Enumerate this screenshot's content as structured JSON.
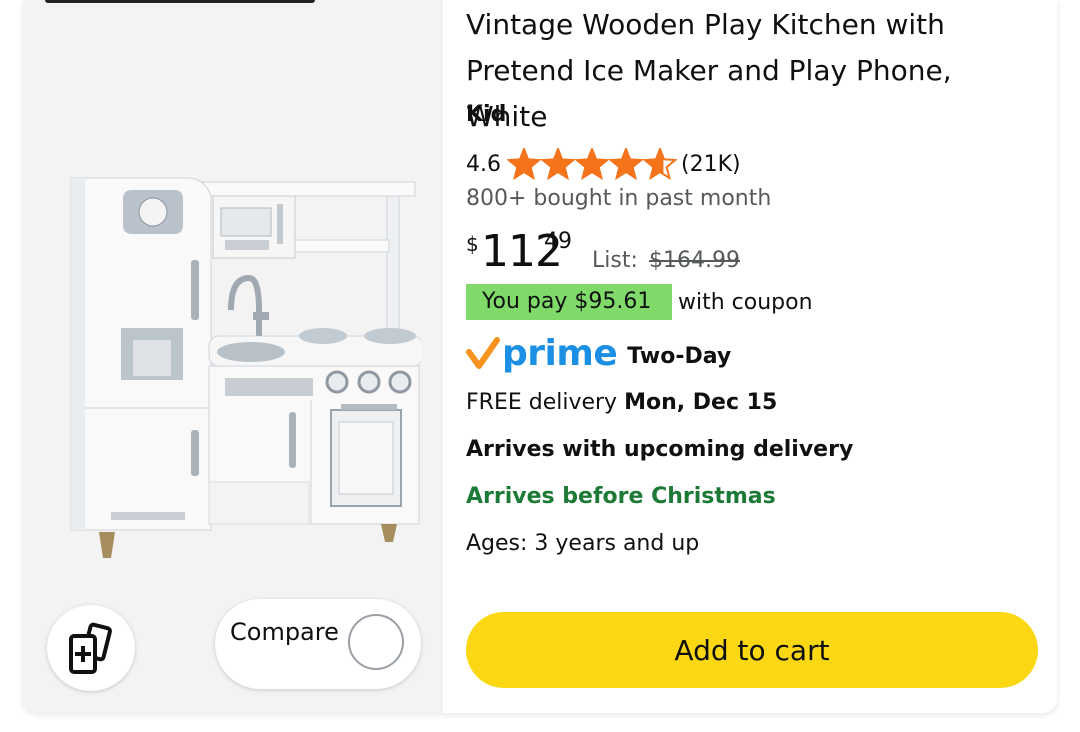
{
  "product": {
    "title": "Vintage Wooden Play Kitchen with Pretend Ice Maker and Play Phone, White",
    "brand": "Kid",
    "rating": "4.6",
    "rating_value": 4.6,
    "rating_count": "(21K)",
    "bought": "800+ bought in past month"
  },
  "price": {
    "symbol": "$",
    "whole": "112",
    "fraction": "49",
    "list_label": "List:",
    "list_price": "$164.99"
  },
  "coupon": {
    "badge": "You pay $95.61",
    "text": "with coupon"
  },
  "prime": {
    "logo_text": "prime",
    "type": "Two-Day"
  },
  "delivery": {
    "prefix": "FREE delivery",
    "date": "Mon, Dec 15"
  },
  "arrives_upcoming": "Arrives with upcoming delivery",
  "arrives_christmas": "Arrives before Christmas",
  "ages": "Ages: 3 years and up",
  "actions": {
    "compare_label": "Compare",
    "add_to_cart": "Add to cart"
  },
  "colors": {
    "star": "#f5731a",
    "coupon_bg": "#7fda69",
    "prime_blue": "#1a8fe3",
    "prime_check": "#f7931e",
    "christmas_green": "#1d7a36",
    "cart_button": "#fcd814"
  },
  "icons": {
    "compare_cards": "add-to-compare-cards-icon",
    "prime_check": "prime-checkmark-icon",
    "star": "star-icon"
  }
}
